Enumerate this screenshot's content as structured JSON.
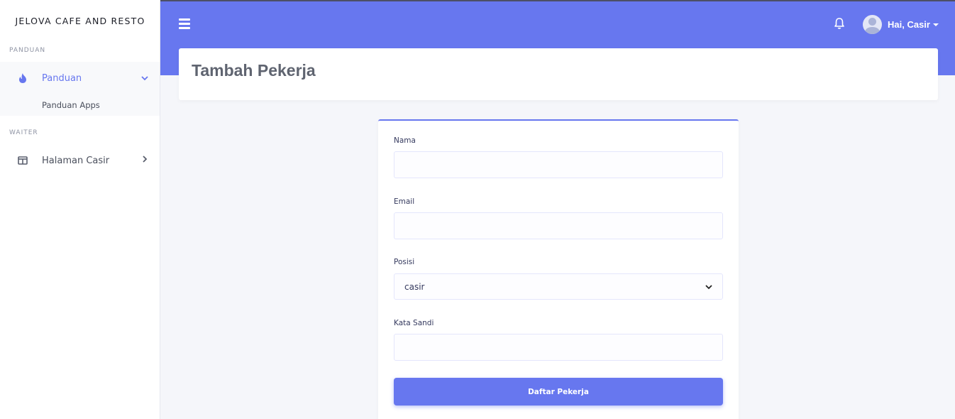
{
  "brand": "JELOVA CAFE AND RESTO",
  "sidebar": {
    "sections": [
      {
        "label": "PANDUAN"
      },
      {
        "label": "WAITER"
      }
    ],
    "panduan": {
      "label": "Panduan",
      "sub_item": "Panduan Apps",
      "icon": "fire-icon",
      "color": "#6777ef"
    },
    "casir": {
      "label": "Halaman Casir",
      "icon": "columns-icon"
    }
  },
  "topbar": {
    "user_greeting": "Hai, Casir",
    "accent": "#6777ef"
  },
  "page": {
    "title": "Tambah Pekerja"
  },
  "form": {
    "nama_label": "Nama",
    "email_label": "Email",
    "posisi_label": "Posisi",
    "posisi_value": "casir",
    "sandi_label": "Kata Sandi",
    "submit_label": "Daftar Pekerja"
  }
}
